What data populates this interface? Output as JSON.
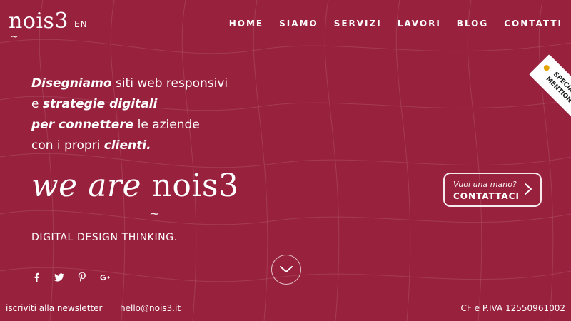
{
  "brand": {
    "logo": "nois3",
    "lang": "EN"
  },
  "nav": {
    "items": [
      "HOME",
      "SIAMO",
      "SERVIZI",
      "LAVORI",
      "BLOG",
      "CONTATTI"
    ]
  },
  "hero": {
    "headline": {
      "line1_bold": "Disegniamo",
      "line1_rest": " siti web responsivi",
      "line2_prefix": "e ",
      "line2_bold": "strategie digitali",
      "line3_bold": "per connettere",
      "line3_rest": " le aziende",
      "line4_prefix": "con i propri ",
      "line4_bold": "clienti."
    },
    "wearer": "we are",
    "wearer_brand": "nois3",
    "tagline": "DIGITAL DESIGN THINKING."
  },
  "cta": {
    "small": "Vuoi una mano?",
    "big": "CONTATTACI"
  },
  "ribbon": {
    "line1": "SPECIAL",
    "line2": "MENTION"
  },
  "social": {
    "icons": [
      "facebook-icon",
      "twitter-icon",
      "pinterest-icon",
      "google-plus-icon"
    ]
  },
  "footer": {
    "newsletter": "iscriviti alla newsletter",
    "email": "hello@nois3.it",
    "cf": "CF e P.IVA 12550961002"
  },
  "colors": {
    "background": "#9a2440",
    "text": "#ffffff"
  }
}
